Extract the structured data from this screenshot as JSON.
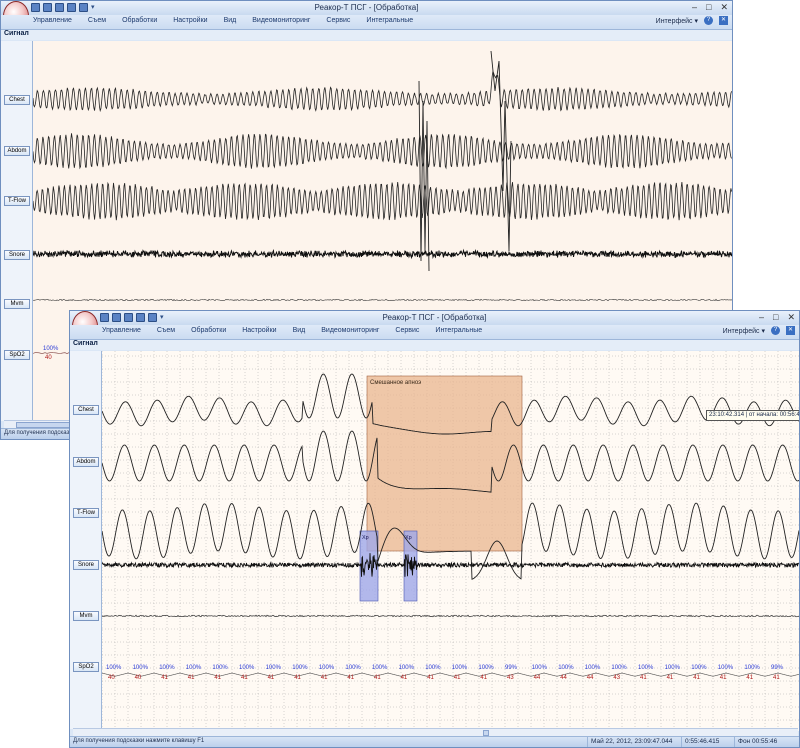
{
  "back_window": {
    "title": "Реакор-Т ПСГ - [Обработка]",
    "panel_header": "Сигнал",
    "status_hint": "Для получения подсказ",
    "channels": [
      "Chest",
      "Abdom",
      "T-Flow",
      "Snore",
      "Mvm",
      "SpO2"
    ],
    "spo2_value": "100%",
    "spo2_secondary": "40"
  },
  "front_window": {
    "title": "Реакор-Т ПСГ - [Обработка]",
    "panel_header": "Сигнал",
    "status_hint": "Для получения подсказки нажмите клавишу F1",
    "status_datetime": "Май 22, 2012, 23:09:47.044",
    "status_position": "0:55:46.415",
    "status_background": "Фон 00:55:46",
    "channels": [
      "Chest",
      "Abdom",
      "T-Flow",
      "Snore",
      "Mvm",
      "SpO2"
    ],
    "events": {
      "apnea_label": "Смешанное апноэ",
      "snore1_label": "Хр",
      "snore2_label": "Хр"
    },
    "tooltip": "23:10:42.314 | от начала: 00:56:4",
    "spo2_values": [
      "100%",
      "100%",
      "100%",
      "100%",
      "100%",
      "100%",
      "100%",
      "100%",
      "100%",
      "100%",
      "100%",
      "100%",
      "100%",
      "100%",
      "100%",
      "99%",
      "100%",
      "100%",
      "100%",
      "100%",
      "100%",
      "100%",
      "100%",
      "100%",
      "100%",
      "99%"
    ],
    "spo2_secondary": [
      "40",
      "40",
      "41",
      "41",
      "41",
      "41",
      "41",
      "41",
      "41",
      "41",
      "41",
      "41",
      "41",
      "41",
      "41",
      "43",
      "44",
      "44",
      "44",
      "43",
      "41",
      "41",
      "41",
      "41",
      "41",
      "41"
    ]
  },
  "menu": {
    "items": [
      "Управление",
      "Съем",
      "Обработки",
      "Настройки",
      "Вид",
      "Видеомониторинг",
      "Сервис",
      "Интегральные"
    ],
    "interface_label": "Интерфейс",
    "help_icon": "help-icon",
    "close_doc_icon": "close-icon"
  },
  "window_controls": {
    "minimize": "–",
    "maximize": "□",
    "close": "✕"
  },
  "colors": {
    "plot_bg_back": "#fdf4ec",
    "plot_bg_front": "#fffaf4",
    "apnea_fill": "#e9b58f",
    "snore_fill": "#9fa8e8",
    "spo2_text": "#2b3bd6",
    "spo2_secondary_text": "#b01818"
  }
}
